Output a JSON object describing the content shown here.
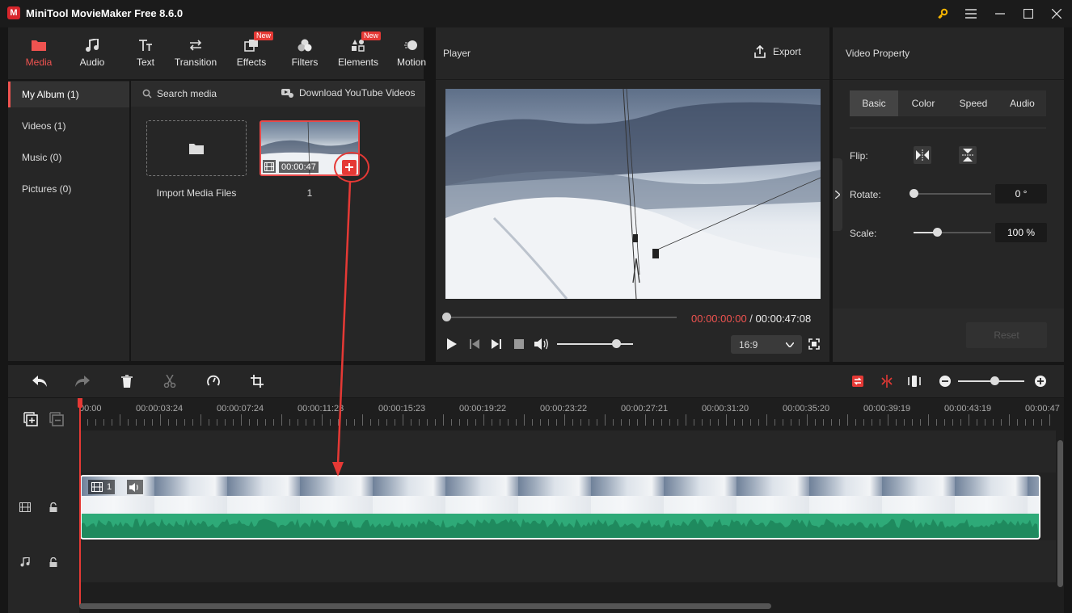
{
  "app": {
    "title": "MiniTool MovieMaker Free 8.6.0",
    "logo_letter": "M"
  },
  "toolbar": {
    "items": [
      {
        "label": "Media"
      },
      {
        "label": "Audio"
      },
      {
        "label": "Text"
      },
      {
        "label": "Transition"
      },
      {
        "label": "Effects",
        "badge": "New"
      },
      {
        "label": "Filters"
      },
      {
        "label": "Elements",
        "badge": "New"
      },
      {
        "label": "Motion"
      }
    ]
  },
  "sidebar": {
    "items": [
      {
        "label": "My Album (1)"
      },
      {
        "label": "Videos (1)"
      },
      {
        "label": "Music (0)"
      },
      {
        "label": "Pictures (0)"
      }
    ]
  },
  "media": {
    "search_placeholder": "Search media",
    "download_label": "Download YouTube Videos",
    "import_label": "Import Media Files",
    "clip": {
      "duration": "00:00:47",
      "name": "1"
    }
  },
  "player": {
    "title": "Player",
    "export_label": "Export",
    "time_current": "00:00:00:00",
    "time_separator": " / ",
    "time_total": "00:00:47:08",
    "aspect": "16:9",
    "seek_progress": 0.0,
    "volume": 0.8
  },
  "property": {
    "title": "Video Property",
    "tabs": [
      "Basic",
      "Color",
      "Speed",
      "Audio"
    ],
    "flip_label": "Flip:",
    "rotate_label": "Rotate:",
    "rotate_value": "0 °",
    "rotate_level": 0.0,
    "scale_label": "Scale:",
    "scale_value": "100 %",
    "scale_level": 0.3,
    "reset_label": "Reset"
  },
  "timeline": {
    "zoom_level": 0.55,
    "ticks": [
      "00:00",
      "00:00:03:24",
      "00:00:07:24",
      "00:00:11:23",
      "00:00:15:23",
      "00:00:19:22",
      "00:00:23:22",
      "00:00:27:21",
      "00:00:31:20",
      "00:00:35:20",
      "00:00:39:19",
      "00:00:43:19",
      "00:00:47"
    ],
    "clip_label": "1"
  },
  "colors": {
    "accent": "#ef5350",
    "waveform": "#2eaa78",
    "time_current": "#ef5350"
  }
}
